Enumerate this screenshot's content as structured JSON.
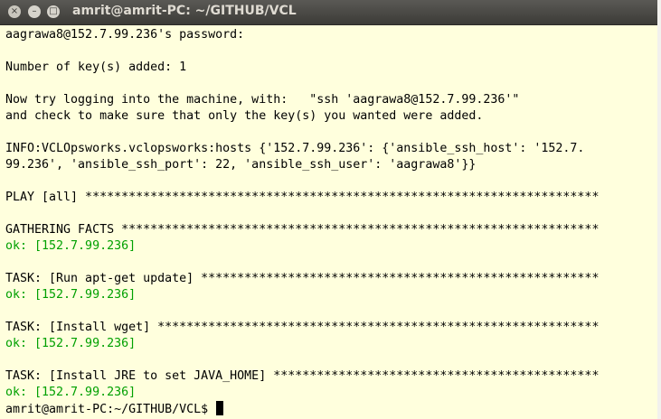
{
  "window": {
    "title": "amrit@amrit-PC: ~/GITHUB/VCL",
    "close_glyph": "×",
    "minimize_glyph": "–",
    "maximize_glyph": "□"
  },
  "terminal": {
    "lines": [
      {
        "text": "aagrawa8@152.7.99.236's password:",
        "type": "normal"
      },
      {
        "text": "",
        "type": "normal"
      },
      {
        "text": "Number of key(s) added: 1",
        "type": "normal"
      },
      {
        "text": "",
        "type": "normal"
      },
      {
        "text": "Now try logging into the machine, with:   \"ssh 'aagrawa8@152.7.99.236'\"",
        "type": "normal"
      },
      {
        "text": "and check to make sure that only the key(s) you wanted were added.",
        "type": "normal"
      },
      {
        "text": "",
        "type": "normal"
      },
      {
        "text": "INFO:VCLOpsworks.vclopsworks:hosts {'152.7.99.236': {'ansible_ssh_host': '152.7.",
        "type": "normal"
      },
      {
        "text": "99.236', 'ansible_ssh_port': 22, 'ansible_ssh_user': 'aagrawa8'}}",
        "type": "normal"
      },
      {
        "text": "",
        "type": "normal"
      },
      {
        "text": "PLAY [all] ***********************************************************************",
        "type": "normal"
      },
      {
        "text": "",
        "type": "normal"
      },
      {
        "text": "GATHERING FACTS ******************************************************************",
        "type": "normal"
      },
      {
        "text": "ok: [152.7.99.236]",
        "type": "ok"
      },
      {
        "text": "",
        "type": "normal"
      },
      {
        "text": "TASK: [Run apt-get update] *******************************************************",
        "type": "normal"
      },
      {
        "text": "ok: [152.7.99.236]",
        "type": "ok"
      },
      {
        "text": "",
        "type": "normal"
      },
      {
        "text": "TASK: [Install wget] *************************************************************",
        "type": "normal"
      },
      {
        "text": "ok: [152.7.99.236]",
        "type": "ok"
      },
      {
        "text": "",
        "type": "normal"
      },
      {
        "text": "TASK: [Install JRE to set JAVA_HOME] *********************************************",
        "type": "normal"
      },
      {
        "text": "ok: [152.7.99.236]",
        "type": "ok"
      }
    ],
    "prompt": "amrit@amrit-PC:~/GITHUB/VCL$ "
  },
  "colors": {
    "terminal_bg": "#ffffdd",
    "ok_text": "#00a000"
  }
}
